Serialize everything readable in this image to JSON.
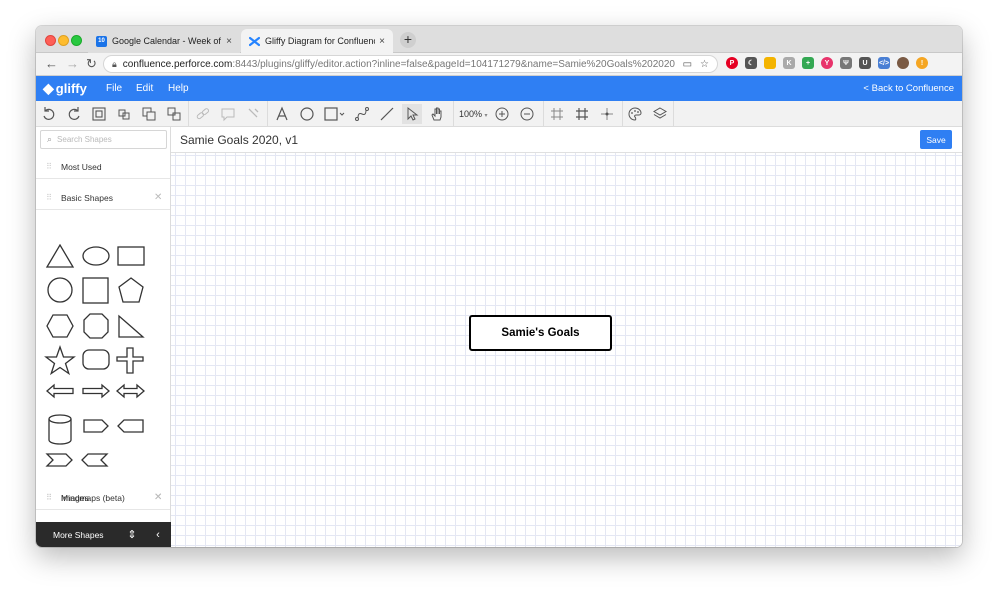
{
  "browser": {
    "tabs": [
      {
        "title": "Google Calendar - Week of Dec",
        "favicon_text": "10",
        "favicon_color": "#1a73e8",
        "active": false
      },
      {
        "title": "Gliffy Diagram for Confluence",
        "favicon_color": "#2684ff",
        "active": true
      }
    ],
    "close_glyph": "×",
    "new_tab_glyph": "+",
    "url_host": "confluence.perforce.com",
    "url_rest": ":8443/plugins/gliffy/editor.action?inline=false&pageId=104171279&name=Samie%20Goals%202020&...",
    "extensions": [
      {
        "name": "pinterest-icon",
        "color": "#e60023",
        "text": "P"
      },
      {
        "name": "moon-icon",
        "color": "#555555",
        "text": "☾"
      },
      {
        "name": "docs-icon",
        "color": "#f4b400",
        "text": ""
      },
      {
        "name": "k-extension-icon",
        "color": "#aaaaaa",
        "text": "K"
      },
      {
        "name": "plus-extension-icon",
        "color": "#34a853",
        "text": "+"
      },
      {
        "name": "y-extension-icon",
        "color": "#e8336b",
        "text": "Y"
      },
      {
        "name": "fork-extension-icon",
        "color": "#777777",
        "text": "Ψ"
      },
      {
        "name": "shield-extension-icon",
        "color": "#555555",
        "text": "U"
      },
      {
        "name": "code-extension-icon",
        "color": "#4a7fd4",
        "text": "</>"
      },
      {
        "name": "avatar-icon",
        "color": "#7a5a44",
        "text": ""
      },
      {
        "name": "notification-icon",
        "color": "#f5a623",
        "text": "!"
      }
    ]
  },
  "app": {
    "logo_text": "gliffy",
    "menu": [
      "File",
      "Edit",
      "Help"
    ],
    "back_label": "< Back to Confluence",
    "zoom_label": "100%",
    "document_title": "Samie Goals 2020, v1",
    "save_label": "Save"
  },
  "sidebar": {
    "search_placeholder": "Search Shapes",
    "sections": {
      "most_used": "Most Used",
      "basic_shapes": "Basic Shapes",
      "images": "Images",
      "mindmaps": "Mindmaps (beta)"
    },
    "more_shapes_label": "More Shapes"
  },
  "canvas": {
    "box_label": "Samie's Goals"
  },
  "colors": {
    "accent": "#2f7ff3",
    "dark_footer": "#2a2a2a",
    "grid": "#e4e7f3"
  }
}
